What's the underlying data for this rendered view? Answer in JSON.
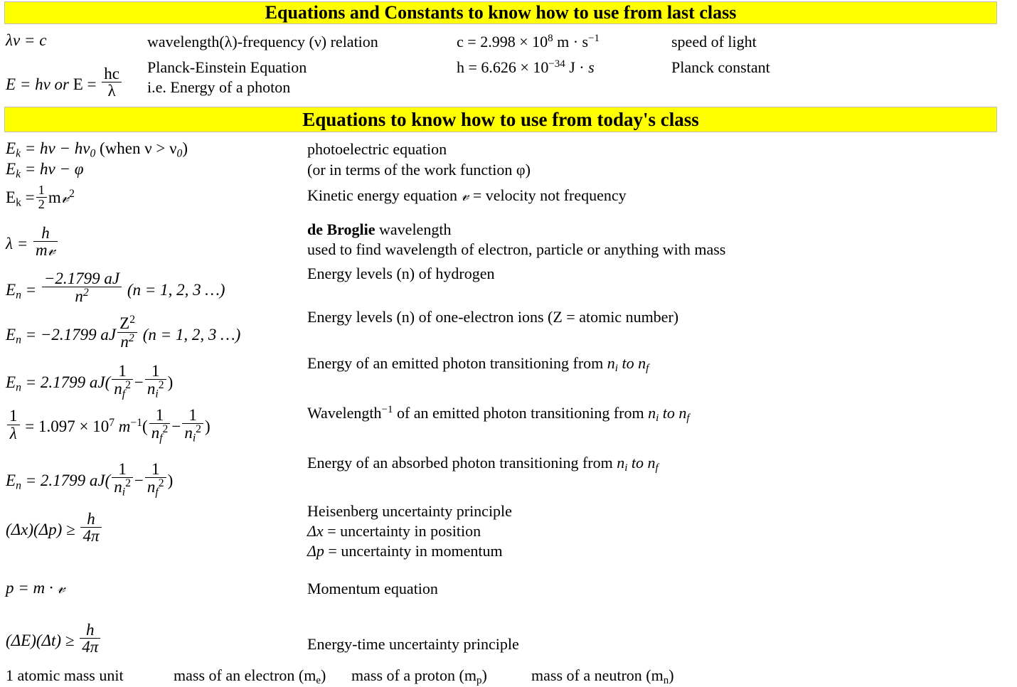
{
  "colors": {
    "banner_background": "#ffff00",
    "banner_border": "#bfbfbf",
    "text": "#000000",
    "page_background": "#ffffff"
  },
  "banners": {
    "last_class": "Equations and Constants to know how to use from last class",
    "today_class": "Equations to know how to use from today's class"
  },
  "last_class": {
    "rows": [
      {
        "equation": "λν = c",
        "description": "wavelength(λ)-frequency (ν) relation",
        "constant_value": "c = 2.998 × 10⁸ m · s⁻¹",
        "constant_name": "speed of light"
      },
      {
        "equation": "E = hν  or E = hc/λ",
        "description_line1": "Planck-Einstein Equation",
        "description_line2": "i.e. Energy of a photon",
        "constant_value": "h = 6.626 × 10⁻³⁴ J · s",
        "constant_name": "Planck constant"
      }
    ],
    "constants": {
      "c_symbol": "c",
      "c_equals": "=",
      "c_mantissa": "2.998",
      "c_times": "×",
      "c_base": "10",
      "c_exponent": "8",
      "c_units_m": "m",
      "c_dot": "·",
      "c_units_s": "s",
      "c_units_s_exp": "−1",
      "h_symbol": "h",
      "h_equals": "=",
      "h_mantissa": "6.626",
      "h_times": "×",
      "h_base": "10",
      "h_exponent": "−34",
      "h_units_J": "J",
      "h_dot": "·",
      "h_units_s": "s"
    }
  },
  "today_class": {
    "photoelectric": {
      "eq_line1_lhs": "E",
      "eq_line1_lhs_sub": "k",
      "eq_line1_body": " = hν − hν",
      "eq_line1_nu0_sub": "0",
      "eq_line1_cond": " (when ν >  ν",
      "eq_line1_cond_sub": "0",
      "eq_line1_close": ")",
      "eq_line2_lhs": "E",
      "eq_line2_lhs_sub": "k",
      "eq_line2_body": " = hν − φ",
      "desc_line1": "photoelectric equation",
      "desc_line2": "(or in terms of the work function φ)"
    },
    "kinetic_energy": {
      "eq_lhs": "E",
      "eq_lhs_sub": "k",
      "eq_equals": "=",
      "frac_num": "1",
      "frac_den": "2",
      "eq_rest": "m",
      "eq_v": "𝓋",
      "eq_exp": "2",
      "desc_a": "Kinetic energy equation ",
      "desc_v": "𝓋",
      "desc_b": " = velocity not frequency"
    },
    "de_broglie": {
      "eq_lhs": "λ  = ",
      "frac_num": "h",
      "frac_den_m": "m",
      "frac_den_v": "𝓋",
      "desc_bold": "de Broglie",
      "desc_rest": " wavelength",
      "desc_line2": "used to find wavelength of electron, particle or anything with mass"
    },
    "hydrogen_levels": {
      "eq_lhs": "E",
      "eq_lhs_sub": "n",
      "eq_equals": " = ",
      "frac_num": "−2.1799 aJ",
      "frac_den": "n",
      "frac_den_exp": "2",
      "eq_cond": " (n = 1, 2, 3 …)",
      "desc": "Energy levels (n) of hydrogen"
    },
    "one_electron_ions": {
      "eq_lhs": "E",
      "eq_lhs_sub": "n",
      "eq_body": " = −2.1799 aJ",
      "frac_num": "Z",
      "frac_num_exp": "2",
      "frac_den": "n",
      "frac_den_exp": "2",
      "eq_cond": " (n = 1, 2, 3 …)",
      "desc": "Energy levels (n) of one-electron ions (Z = atomic number)"
    },
    "emitted_photon_energy": {
      "eq_lhs": "E",
      "eq_lhs_sub": "n",
      "eq_body": " = 2.1799 aJ(",
      "frac1_num": "1",
      "frac1_den_n": "n",
      "frac1_den_sub": "f",
      "frac1_den_exp": "2",
      "eq_minus": "−",
      "frac2_num": "1",
      "frac2_den_n": "n",
      "frac2_den_sub": "i",
      "frac2_den_exp": "2",
      "eq_close": ")",
      "desc_a": "Energy of an emitted photon transitioning from ",
      "desc_ni": "n",
      "desc_ni_sub": "i",
      "desc_to": " to ",
      "desc_nf": "n",
      "desc_nf_sub": "f"
    },
    "rydberg_wavelength": {
      "lhs_num": "1",
      "lhs_den": "λ",
      "eq_body": " = 1.097  × 10",
      "eq_exp": "7",
      "eq_units": " m",
      "eq_units_exp": "−1",
      "eq_open": "(",
      "frac1_num": "1",
      "frac1_den_n": "n",
      "frac1_den_sub": "f",
      "frac1_den_exp": "2",
      "eq_minus": "−",
      "frac2_num": "1",
      "frac2_den_n": "n",
      "frac2_den_sub": "i",
      "frac2_den_exp": "2",
      "eq_close": ")",
      "desc_a": "Wavelength",
      "desc_a_exp": "−1",
      "desc_b": " of an emitted photon transitioning from ",
      "desc_ni": "n",
      "desc_ni_sub": "i",
      "desc_to": " to ",
      "desc_nf": "n",
      "desc_nf_sub": "f"
    },
    "absorbed_photon_energy": {
      "eq_lhs": "E",
      "eq_lhs_sub": "n",
      "eq_body": " = 2.1799 aJ(",
      "frac1_num": "1",
      "frac1_den_n": "n",
      "frac1_den_sub": "i",
      "frac1_den_exp": "2",
      "eq_minus": "−",
      "frac2_num": "1",
      "frac2_den_n": "n",
      "frac2_den_sub": "f",
      "frac2_den_exp": "2",
      "eq_close": ")",
      "desc_a": "Energy of an absorbed photon transitioning from ",
      "desc_ni": "n",
      "desc_ni_sub": "i",
      "desc_to": " to ",
      "desc_nf": "n",
      "desc_nf_sub": "f"
    },
    "heisenberg": {
      "eq_lhs": "(Δx)(Δp) ≥ ",
      "frac_num": "h",
      "frac_den": "4π",
      "desc_line1": " Heisenberg uncertainty principle",
      "desc_line2_sym": "Δx",
      "desc_line2_rest": " = uncertainty in position",
      "desc_line3_sym": "Δp",
      "desc_line3_rest": " = uncertainty in momentum"
    },
    "momentum": {
      "eq_lhs": "p = m · ",
      "eq_v": "𝓋",
      "desc": "Momentum equation"
    },
    "energy_time": {
      "eq_lhs": "(ΔE)(Δt) ≥ ",
      "frac_num": "h",
      "frac_den": "4π",
      "desc": "Energy-time uncertainty principle"
    },
    "masses_row": {
      "amu": "1 atomic mass unit",
      "electron_a": "mass of an electron (m",
      "electron_sub": "e",
      "electron_b": ")",
      "proton_a": "mass of a proton (m",
      "proton_sub": "p",
      "proton_b": ")",
      "neutron_a": "mass of a neutron (m",
      "neutron_sub": "n",
      "neutron_b": ")"
    }
  }
}
